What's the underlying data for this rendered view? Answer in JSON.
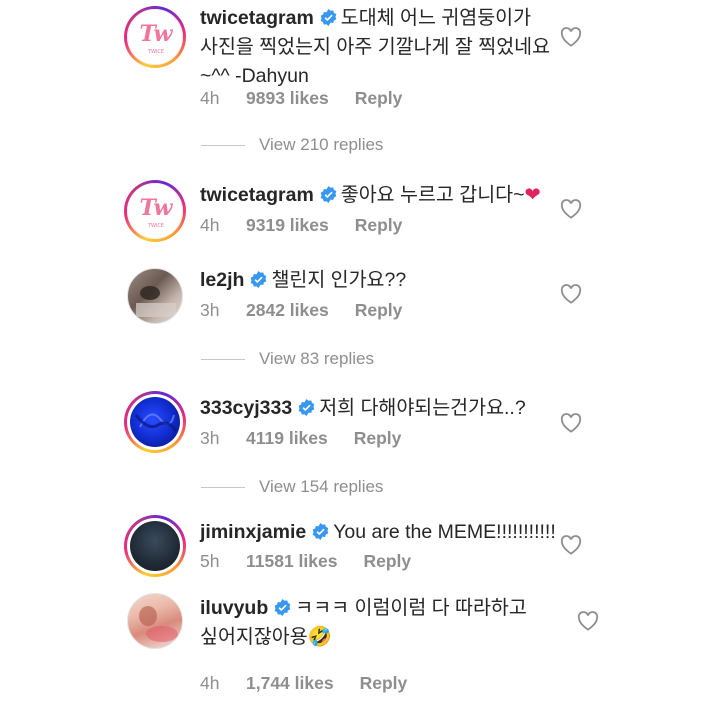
{
  "comments": [
    {
      "username": "twicetagram",
      "verified": true,
      "text_lines": [
        "도대체 어느 귀염둥이가",
        "사진을 찍었는지 아주 기깔나게 잘 찍었네요",
        "~^^ -Dahyun"
      ],
      "time": "4h",
      "likes": "9893 likes",
      "reply": "Reply",
      "avatar": "twice-logo"
    },
    {
      "username": "twicetagram",
      "verified": true,
      "text": "좋아요 누르고 갑니다~",
      "emoji": "❤",
      "time": "4h",
      "likes": "9319 likes",
      "reply": "Reply",
      "avatar": "twice-logo"
    },
    {
      "username": "le2jh",
      "verified": true,
      "text": "챌린지 인가요??",
      "time": "3h",
      "likes": "2842 likes",
      "reply": "Reply",
      "avatar": "photo"
    },
    {
      "username": "333cyj333",
      "verified": true,
      "text": "저희 다해야되는건가요..?",
      "time": "3h",
      "likes": "4119 likes",
      "reply": "Reply",
      "avatar": "blue-photo"
    },
    {
      "username": "jiminxjamie",
      "verified": true,
      "text": "You are the MEME!!!!!!!!!!!",
      "time": "5h",
      "likes": "11581 likes",
      "reply": "Reply",
      "avatar": "dark-photo"
    },
    {
      "username": "iluvyub",
      "verified": true,
      "text_lines": [
        "ㅋㅋㅋ 이럼이럼 다 따라하고",
        "싶어지잖아용"
      ],
      "emoji": "🤣",
      "time": "4h",
      "likes": "1,744 likes",
      "reply": "Reply",
      "avatar": "pink-photo"
    }
  ],
  "view_replies": [
    "View 210 replies",
    "View 83 replies",
    "View 154 replies"
  ],
  "colors": {
    "verified": "#3897f0",
    "meta": "#8e8e8e",
    "text": "#262626"
  }
}
